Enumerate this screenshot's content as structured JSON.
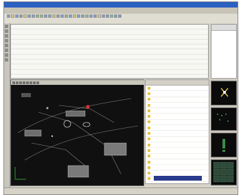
{
  "window": {
    "title": ""
  },
  "menu": {
    "items": [
      "",
      "",
      "",
      "",
      "",
      "",
      "",
      ""
    ]
  },
  "table": {
    "rows": [
      {
        "id": "",
        "name": "",
        "a": "",
        "b": "",
        "c": ""
      },
      {
        "id": "",
        "name": "",
        "a": "",
        "b": "",
        "c": ""
      },
      {
        "id": "",
        "name": "",
        "a": "",
        "b": "",
        "c": ""
      },
      {
        "id": "",
        "name": "",
        "a": "",
        "b": "",
        "c": ""
      },
      {
        "id": "",
        "name": "",
        "a": "",
        "b": "",
        "c": ""
      },
      {
        "id": "",
        "name": "",
        "a": "",
        "b": "",
        "c": ""
      },
      {
        "id": "",
        "name": "",
        "a": "",
        "b": "",
        "c": ""
      },
      {
        "id": "",
        "name": "",
        "a": "",
        "b": "",
        "c": ""
      },
      {
        "id": "",
        "name": "",
        "a": "",
        "b": "",
        "c": ""
      },
      {
        "id": "",
        "name": "",
        "a": "",
        "b": "",
        "c": ""
      },
      {
        "id": "",
        "name": "",
        "a": "",
        "b": "",
        "c": ""
      }
    ]
  },
  "right_list": {
    "items": [
      "",
      "",
      "",
      "",
      "",
      "",
      "",
      "",
      "",
      "",
      "",
      ""
    ]
  },
  "properties": {
    "rows": [
      {
        "label": "",
        "value": ""
      },
      {
        "label": "",
        "value": ""
      },
      {
        "label": "",
        "value": ""
      },
      {
        "label": "",
        "value": ""
      },
      {
        "label": "",
        "value": ""
      },
      {
        "label": "",
        "value": ""
      },
      {
        "label": "",
        "value": ""
      },
      {
        "label": "",
        "value": ""
      },
      {
        "label": "",
        "value": ""
      },
      {
        "label": "",
        "value": ""
      },
      {
        "label": "",
        "value": ""
      },
      {
        "label": "",
        "value": ""
      },
      {
        "label": "",
        "value": ""
      },
      {
        "label": "",
        "value": ""
      },
      {
        "label": "",
        "value": ""
      },
      {
        "label": "",
        "value": ""
      },
      {
        "label": "",
        "value": ""
      },
      {
        "label": "",
        "value": ""
      }
    ],
    "footer": ""
  },
  "status": {
    "left": "",
    "middle": "",
    "right": ""
  },
  "colors": {
    "title_bar": "#2b5fc0",
    "workspace": "#101010",
    "highlight_marker": "#e03030",
    "property_icon": "#e6c040",
    "value_text": "#cc4444",
    "footer_bar": "#2a3a8c"
  }
}
